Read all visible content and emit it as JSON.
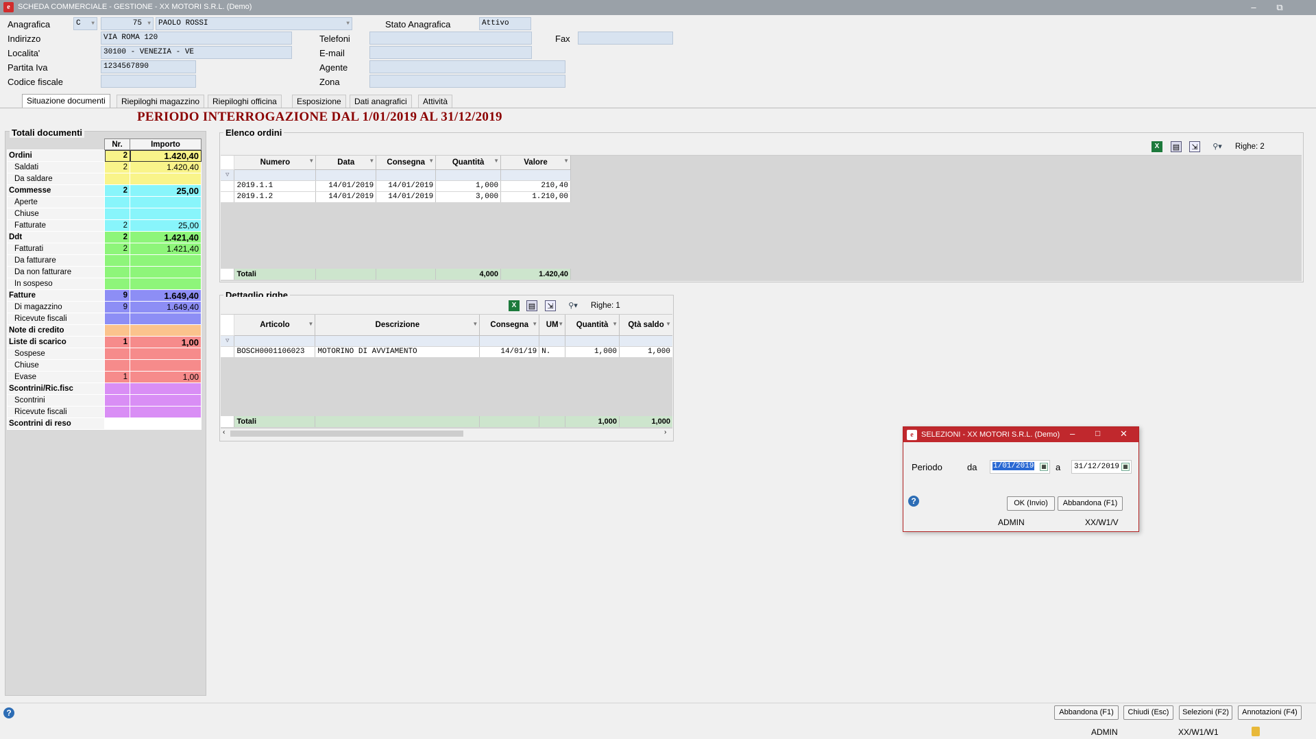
{
  "window": {
    "title": "SCHEDA COMMERCIALE - GESTIONE - XX  MOTORI S.R.L.  (Demo)",
    "min": "–",
    "restore": "⧉"
  },
  "header": {
    "anagrafica_label": "Anagrafica",
    "anagrafica_type": "C",
    "anagrafica_code": "75",
    "anagrafica_name": "PAOLO ROSSI",
    "stato_label": "Stato Anagrafica",
    "stato_value": "Attivo",
    "indirizzo_label": "Indirizzo",
    "indirizzo_value": "VIA ROMA 120",
    "localita_label": "Localita'",
    "localita_value": "30100 - VENEZIA - VE",
    "piva_label": "Partita Iva",
    "piva_value": "1234567890",
    "cf_label": "Codice fiscale",
    "cf_value": "",
    "telefoni_label": "Telefoni",
    "email_label": "E-mail",
    "agente_label": "Agente",
    "zona_label": "Zona",
    "fax_label": "Fax"
  },
  "tabs": [
    "Situazione documenti",
    "Riepiloghi magazzino",
    "Riepiloghi officina",
    "Esposizione",
    "Dati anagrafici",
    "Attività"
  ],
  "period_title": "PERIODO INTERROGAZIONE DAL  1/01/2019 AL 31/12/2019",
  "totali": {
    "title": "Totali documenti",
    "col_nr": "Nr.",
    "col_importo": "Importo",
    "rows": [
      {
        "label": "Ordini",
        "nr": "2",
        "imp": "1.420,40",
        "bold": true,
        "color": "#f9f48a"
      },
      {
        "label": "Saldati",
        "nr": "2",
        "imp": "1.420,40",
        "bold": false,
        "color": "#f9f48a"
      },
      {
        "label": "Da saldare",
        "nr": "",
        "imp": "",
        "bold": false,
        "color": "#f9f48a"
      },
      {
        "label": "Commesse",
        "nr": "2",
        "imp": "25,00",
        "bold": true,
        "color": "#88f5fb"
      },
      {
        "label": "Aperte",
        "nr": "",
        "imp": "",
        "bold": false,
        "color": "#88f5fb"
      },
      {
        "label": "Chiuse",
        "nr": "",
        "imp": "",
        "bold": false,
        "color": "#88f5fb"
      },
      {
        "label": "Fatturate",
        "nr": "2",
        "imp": "25,00",
        "bold": false,
        "color": "#88f5fb"
      },
      {
        "label": "Ddt",
        "nr": "2",
        "imp": "1.421,40",
        "bold": true,
        "color": "#8ef57a"
      },
      {
        "label": "Fatturati",
        "nr": "2",
        "imp": "1.421,40",
        "bold": false,
        "color": "#8ef57a"
      },
      {
        "label": "Da fatturare",
        "nr": "",
        "imp": "",
        "bold": false,
        "color": "#8ef57a"
      },
      {
        "label": "Da non fatturare",
        "nr": "",
        "imp": "",
        "bold": false,
        "color": "#8ef57a"
      },
      {
        "label": "In sospeso",
        "nr": "",
        "imp": "",
        "bold": false,
        "color": "#8ef57a"
      },
      {
        "label": "Fatture",
        "nr": "9",
        "imp": "1.649,40",
        "bold": true,
        "color": "#8d8ef5"
      },
      {
        "label": "Di magazzino",
        "nr": "9",
        "imp": "1.649,40",
        "bold": false,
        "color": "#8d8ef5"
      },
      {
        "label": "Ricevute fiscali",
        "nr": "",
        "imp": "",
        "bold": false,
        "color": "#8d8ef5"
      },
      {
        "label": "Note di credito",
        "nr": "",
        "imp": "",
        "bold": true,
        "color": "#fbc38d"
      },
      {
        "label": "Liste di scarico",
        "nr": "1",
        "imp": "1,00",
        "bold": true,
        "color": "#f68b8b"
      },
      {
        "label": "Sospese",
        "nr": "",
        "imp": "",
        "bold": false,
        "color": "#f68b8b"
      },
      {
        "label": "Chiuse",
        "nr": "",
        "imp": "",
        "bold": false,
        "color": "#f68b8b"
      },
      {
        "label": "Evase",
        "nr": "1",
        "imp": "1,00",
        "bold": false,
        "color": "#f68b8b"
      },
      {
        "label": "Scontrini/Ric.fisc",
        "nr": "",
        "imp": "",
        "bold": true,
        "color": "#d98ef5"
      },
      {
        "label": "Scontrini",
        "nr": "",
        "imp": "",
        "bold": false,
        "color": "#d98ef5"
      },
      {
        "label": "Ricevute fiscali",
        "nr": "",
        "imp": "",
        "bold": false,
        "color": "#d98ef5"
      },
      {
        "label": "Scontrini di reso",
        "nr": "",
        "imp": "",
        "bold": true,
        "color": "#ffffff"
      }
    ]
  },
  "ordini": {
    "title": "Elenco ordini",
    "righe": "Righe: 2",
    "columns": [
      "Numero",
      "Data",
      "Consegna",
      "Quantità",
      "Valore"
    ],
    "rows": [
      [
        "2019.1.1",
        "14/01/2019",
        "14/01/2019",
        "1,000",
        "210,40"
      ],
      [
        "2019.1.2",
        "14/01/2019",
        "14/01/2019",
        "3,000",
        "1.210,00"
      ]
    ],
    "totali_label": "Totali",
    "tot_qta": "4,000",
    "tot_val": "1.420,40"
  },
  "dettaglio": {
    "title": "Dettaglio righe",
    "righe": "Righe: 1",
    "columns": [
      "Articolo",
      "Descrizione",
      "Consegna",
      "UM",
      "Quantità",
      "Qtà saldo"
    ],
    "rows": [
      [
        "BOSCH0001106023",
        "MOTORINO DI AVVIAMENTO",
        "14/01/19",
        "N.",
        "1,000",
        "1,000"
      ]
    ],
    "totali_label": "Totali",
    "tot_qta": "1,000",
    "tot_saldo": "1,000"
  },
  "dialog": {
    "title": "SELEZIONI - XX  MOTORI S.R.L.  (Demo)",
    "periodo_label": "Periodo",
    "da_label": "da",
    "a_label": "a",
    "da_value": "1/01/2019",
    "a_value": "31/12/2019",
    "ok": "OK (Invio)",
    "abbandona": "Abbandona (F1)",
    "user": "ADMIN",
    "path": "XX/W1/V"
  },
  "footer": {
    "abbandona": "Abbandona (F1)",
    "chiudi": "Chiudi (Esc)",
    "selezioni": "Selezioni (F2)",
    "annotazioni": "Annotazioni (F4)",
    "user": "ADMIN",
    "path": "XX/W1/W1"
  },
  "colors": {
    "accent": "#c0282d",
    "period": "#8b0000",
    "field": "#d8e3f0",
    "totals_row": "#cde5cd"
  }
}
